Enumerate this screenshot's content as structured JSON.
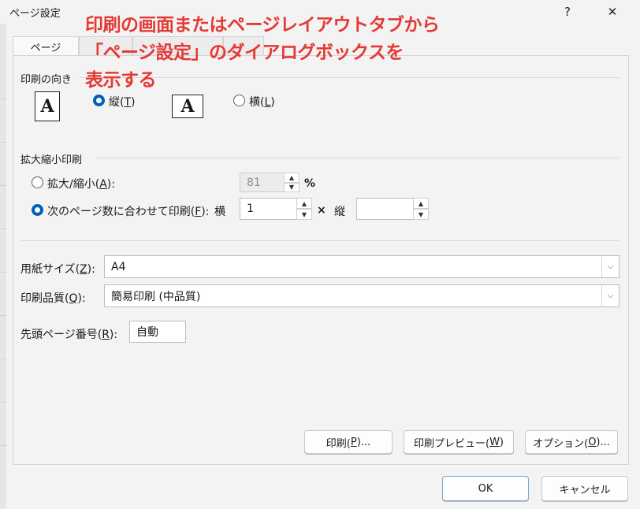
{
  "window": {
    "title": "ページ設定",
    "help_label": "?",
    "close_label": "✕"
  },
  "tabs": [
    {
      "label": "ページ"
    }
  ],
  "orientation": {
    "group_label": "印刷の向き",
    "portrait_label": "縦(T)",
    "landscape_label": "横(L)",
    "selected": "portrait",
    "portrait_icon_glyph": "A",
    "landscape_icon_glyph": "A"
  },
  "scaling": {
    "group_label": "拡大縮小印刷",
    "adjust_label": "拡大/縮小(A):",
    "adjust_value": "81",
    "percent_unit": "%",
    "fit_label": "次のページ数に合わせて印刷(F):",
    "wide_label": "横",
    "wide_value": "1",
    "times_label": "×",
    "tall_label": "縦",
    "tall_value": "",
    "selected": "fit"
  },
  "paper": {
    "size_label": "用紙サイズ(Z):",
    "size_value": "A4",
    "quality_label": "印刷品質(Q):",
    "quality_value": "簡易印刷 (中品質)",
    "first_page_label": "先頭ページ番号(R):",
    "first_page_value": "自動"
  },
  "actions": {
    "print_label": "印刷(P)...",
    "preview_label": "印刷プレビュー(W)",
    "options_label": "オプション(O)...",
    "ok_label": "OK",
    "cancel_label": "キャンセル"
  },
  "annotation": {
    "line1": "印刷の画面またはページレイアウトタブから",
    "line2": "「ページ設定」のダイアログボックスを",
    "line3": "表示する",
    "color": "#e53935"
  },
  "colors": {
    "accent": "#005fb8",
    "dialog_bg": "#f3f3f3"
  }
}
